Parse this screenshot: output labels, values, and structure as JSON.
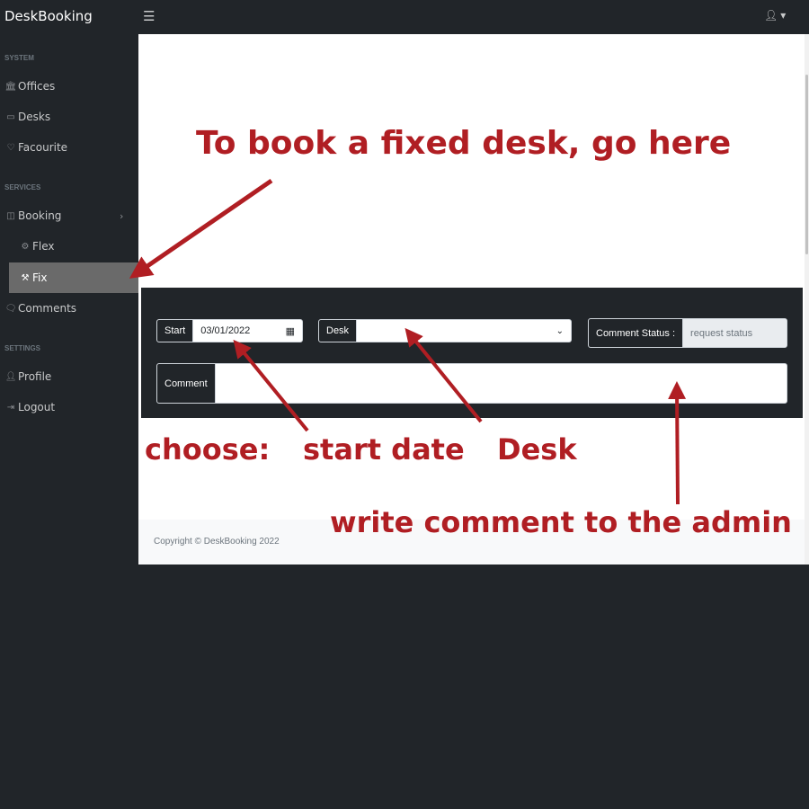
{
  "header": {
    "brand": "DeskBooking",
    "menu_icon": "hamburger-icon",
    "user_icon": "user-icon"
  },
  "sidebar": {
    "headings": {
      "system": "SYSTEM",
      "services": "SERVICES",
      "settings": "SETTINGS"
    },
    "items": [
      {
        "label": "Offices",
        "icon": "building-icon"
      },
      {
        "label": "Desks",
        "icon": "monitor-icon"
      },
      {
        "label": "Facourite",
        "icon": "heart-icon"
      },
      {
        "label": "Booking",
        "icon": "layout-icon"
      },
      {
        "label": "Flex",
        "icon": "cog-icon"
      },
      {
        "label": "Fix",
        "icon": "tools-icon"
      },
      {
        "label": "Comments",
        "icon": "comments-icon"
      },
      {
        "label": "Profile",
        "icon": "user-icon"
      },
      {
        "label": "Logout",
        "icon": "logout-icon"
      }
    ]
  },
  "form": {
    "start_label": "Start",
    "start_value": "03/01/2022",
    "desk_label": "Desk",
    "desk_value": "",
    "comment_status_label": "Comment Status :",
    "comment_status_placeholder": "request status",
    "comment_label": "Comment",
    "comment_value": ""
  },
  "footer": {
    "copyright": "Copyright © DeskBooking 2022"
  },
  "annotations": {
    "go_here": "To book a fixed desk, go here",
    "choose": "choose:",
    "start_date": "start date",
    "desk": "Desk",
    "write_comment": "write comment to the admin"
  },
  "colors": {
    "annotation": "#b01e23",
    "sidebar_bg": "#212529",
    "active_item": "#6a6a6a"
  }
}
